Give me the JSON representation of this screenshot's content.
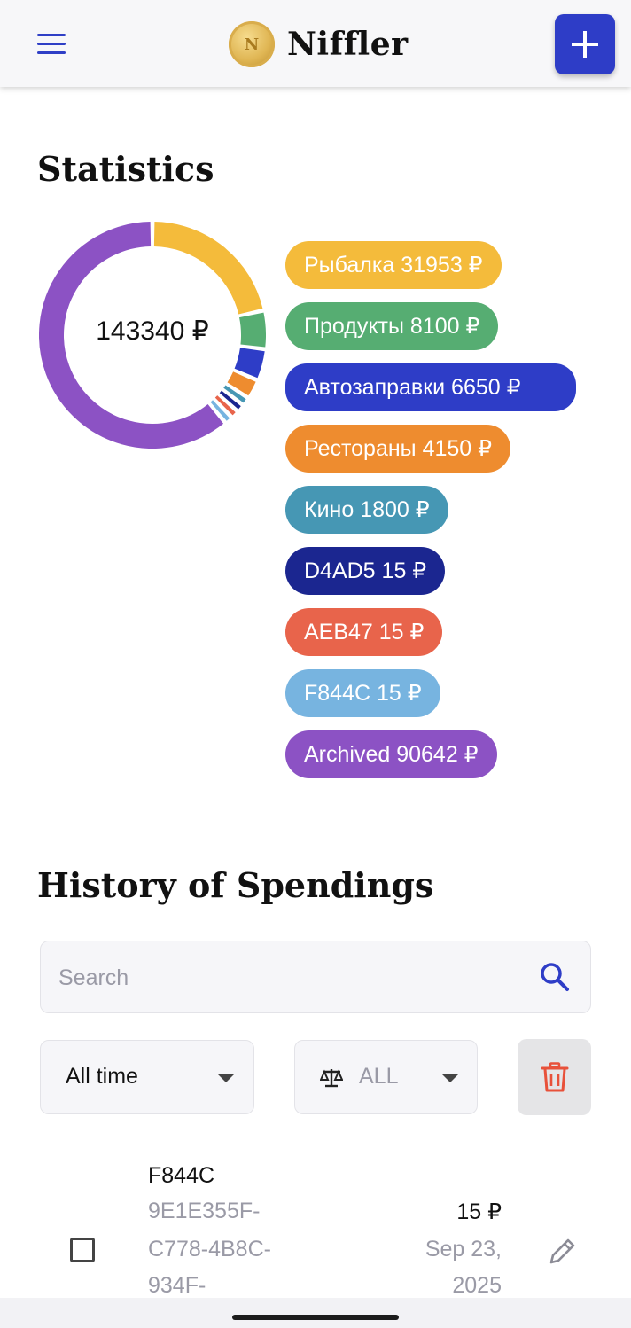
{
  "header": {
    "app_name": "Niffler",
    "logo_letter": "N",
    "menu_icon": "hamburger-icon",
    "add_icon": "plus-icon",
    "accent": "#2e3dc7"
  },
  "statistics": {
    "title": "Statistics",
    "total": "143340 ₽",
    "legend": [
      {
        "label": "Рыбалка 31953 ₽",
        "color": "#f4bb3b"
      },
      {
        "label": "Продукты 8100 ₽",
        "color": "#56ad72"
      },
      {
        "label": "Автозаправки 6650 ₽",
        "color": "#2e3dc7"
      },
      {
        "label": "Рестораны 4150 ₽",
        "color": "#ee8c2f"
      },
      {
        "label": "Кино 1800 ₽",
        "color": "#4697b4"
      },
      {
        "label": "D4AD5 15 ₽",
        "color": "#1b2690"
      },
      {
        "label": "AEB47 15 ₽",
        "color": "#e8644b"
      },
      {
        "label": "F844C 15 ₽",
        "color": "#77b4e0"
      },
      {
        "label": "Archived 90642 ₽",
        "color": "#8c52c4"
      }
    ]
  },
  "chart_data": {
    "type": "pie",
    "categories": [
      "Рыбалка",
      "Продукты",
      "Автозаправки",
      "Рестораны",
      "Кино",
      "D4AD5",
      "AEB47",
      "F844C",
      "Archived"
    ],
    "values": [
      31953,
      8100,
      6650,
      4150,
      1800,
      15,
      15,
      15,
      90642
    ],
    "colors": [
      "#f4bb3b",
      "#56ad72",
      "#2e3dc7",
      "#ee8c2f",
      "#4697b4",
      "#1b2690",
      "#e8644b",
      "#77b4e0",
      "#8c52c4"
    ],
    "center_label": "143340 ₽"
  },
  "history": {
    "title": "History of Spendings",
    "search": {
      "placeholder": "Search",
      "value": "",
      "icon": "search-icon"
    },
    "period_select": {
      "value": "All time",
      "icon": "chevron-down-icon"
    },
    "currency_select": {
      "value": "ALL",
      "icon": "scales-icon"
    },
    "delete_icon": "trash-icon",
    "row": {
      "category": "F844C",
      "description_lines": [
        "9E1E355F-",
        "C778-4B8C-",
        "934F-"
      ],
      "amount": "15 ₽",
      "date_lines": [
        "Sep 23,",
        "2025"
      ],
      "edit_icon": "pencil-icon"
    }
  }
}
